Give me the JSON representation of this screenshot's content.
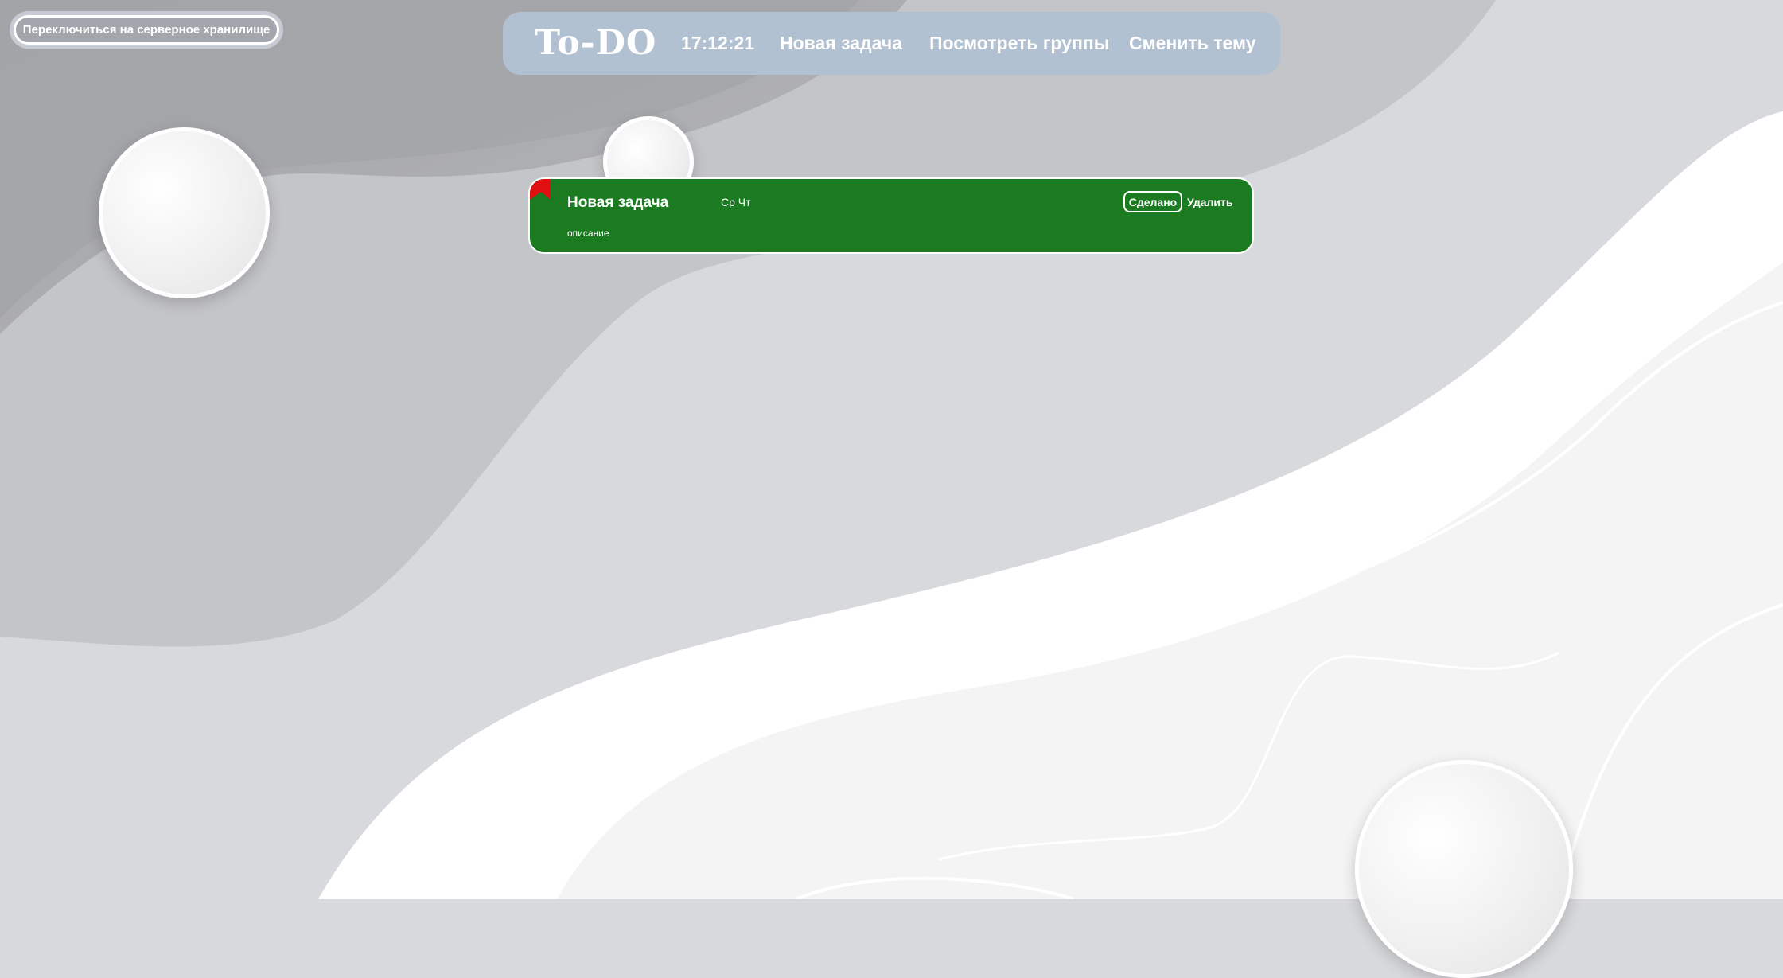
{
  "storage_toggle": {
    "label": "Переключиться на серверное хранилище"
  },
  "navbar": {
    "brand": "To-DO",
    "clock": "17:12:21",
    "new_task": "Новая задача",
    "view_groups": "Посмотреть группы",
    "change_theme": "Сменить тему"
  },
  "tasks": [
    {
      "title": "Новая задача",
      "days": "Ср Чт",
      "description": "описание",
      "done_label": "Сделано",
      "delete_label": "Удалить",
      "card_color": "#1b7b20",
      "flag_color": "#e01010"
    }
  ],
  "colors": {
    "navbar_bg": "#b2c1d1",
    "background": "#d8d9dc"
  }
}
